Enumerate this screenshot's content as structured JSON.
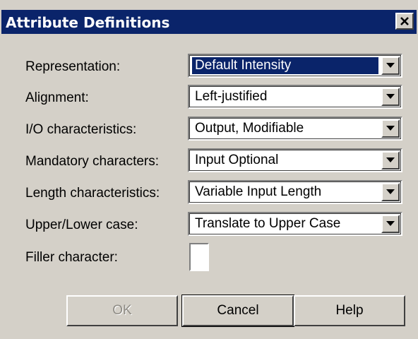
{
  "window": {
    "title": "Attribute Definitions",
    "close_symbol": "✕"
  },
  "fields": [
    {
      "label": "Representation:",
      "value": "Default Intensity",
      "selected": true
    },
    {
      "label": "Alignment:",
      "value": "Left-justified",
      "selected": false
    },
    {
      "label": "I/O characteristics:",
      "value": "Output, Modifiable",
      "selected": false
    },
    {
      "label": "Mandatory characters:",
      "value": "Input Optional",
      "selected": false
    },
    {
      "label": "Length characteristics:",
      "value": "Variable Input Length",
      "selected": false
    },
    {
      "label": "Upper/Lower case:",
      "value": "Translate to Upper Case",
      "selected": false
    }
  ],
  "filler": {
    "label": "Filler character:",
    "value": ""
  },
  "buttons": {
    "ok": "OK",
    "cancel": "Cancel",
    "help": "Help"
  },
  "colors": {
    "titlebar": "#0a246a",
    "selection": "#0a246a",
    "face": "#d4d0c8"
  },
  "icons": {
    "close": "close-icon",
    "dropdown": "chevron-down-icon"
  }
}
